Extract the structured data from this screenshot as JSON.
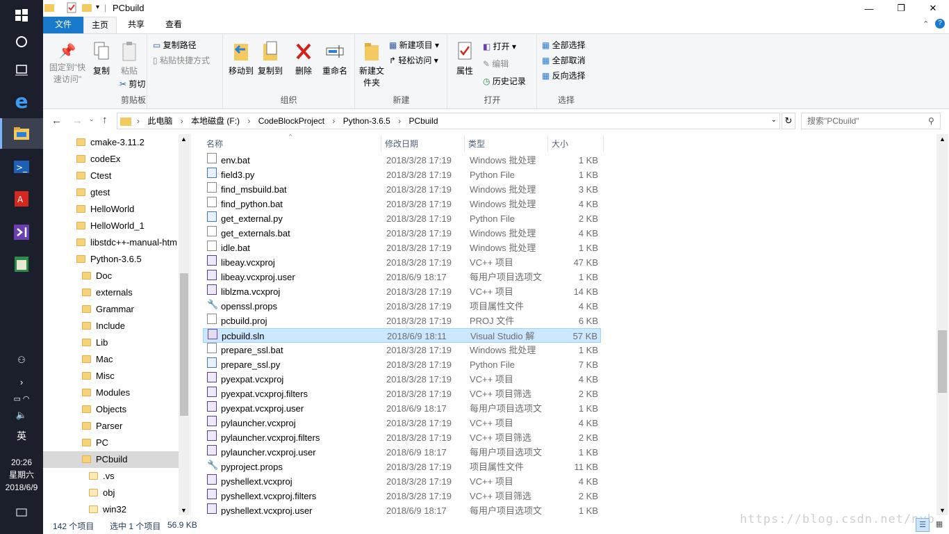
{
  "taskbar": {
    "clock_time": "20:26",
    "clock_day": "星期六",
    "clock_date": "2018/6/9",
    "ime": "英"
  },
  "window": {
    "title": "PCbuild",
    "minimize": "—",
    "maximize": "❐",
    "close": "✕"
  },
  "tabs": {
    "file": "文件",
    "home": "主页",
    "share": "共享",
    "view": "查看"
  },
  "ribbon": {
    "clipboard": {
      "pin": "固定到\"快速访问\"",
      "copy": "复制",
      "paste": "粘贴",
      "copy_path": "复制路径",
      "paste_shortcut": "粘贴快捷方式",
      "cut": "剪切",
      "label": "剪贴板"
    },
    "organize": {
      "move_to": "移动到",
      "copy_to": "复制到",
      "delete": "删除",
      "rename": "重命名",
      "label": "组织"
    },
    "new": {
      "new_folder": "新建文件夹",
      "new_item": "新建项目",
      "easy_access": "轻松访问",
      "label": "新建"
    },
    "open": {
      "properties": "属性",
      "open": "打开",
      "edit": "编辑",
      "history": "历史记录",
      "label": "打开"
    },
    "select": {
      "select_all": "全部选择",
      "select_none": "全部取消",
      "invert": "反向选择",
      "label": "选择"
    }
  },
  "address": {
    "crumbs": [
      "此电脑",
      "本地磁盘 (F:)",
      "CodeBlockProject",
      "Python-3.6.5",
      "PCbuild"
    ],
    "search_placeholder": "搜索\"PCbuild\""
  },
  "nav": {
    "items": [
      {
        "label": "cmake-3.11.2",
        "level": 0
      },
      {
        "label": "codeEx",
        "level": 0
      },
      {
        "label": "Ctest",
        "level": 0
      },
      {
        "label": "gtest",
        "level": 0
      },
      {
        "label": "HelloWorld",
        "level": 0
      },
      {
        "label": "HelloWorld_1",
        "level": 0
      },
      {
        "label": "libstdc++-manual-htm",
        "level": 0
      },
      {
        "label": "Python-3.6.5",
        "level": 0
      },
      {
        "label": "Doc",
        "level": 1
      },
      {
        "label": "externals",
        "level": 1
      },
      {
        "label": "Grammar",
        "level": 1
      },
      {
        "label": "Include",
        "level": 1
      },
      {
        "label": "Lib",
        "level": 1
      },
      {
        "label": "Mac",
        "level": 1
      },
      {
        "label": "Misc",
        "level": 1
      },
      {
        "label": "Modules",
        "level": 1
      },
      {
        "label": "Objects",
        "level": 1
      },
      {
        "label": "Parser",
        "level": 1
      },
      {
        "label": "PC",
        "level": 1
      },
      {
        "label": "PCbuild",
        "level": 1,
        "selected": true
      },
      {
        "label": ".vs",
        "level": 2
      },
      {
        "label": "obj",
        "level": 2
      },
      {
        "label": "win32",
        "level": 2
      }
    ]
  },
  "columns": {
    "name": "名称",
    "date": "修改日期",
    "type": "类型",
    "size": "大小"
  },
  "files": [
    {
      "name": "env.bat",
      "date": "2018/3/28 17:19",
      "type": "Windows 批处理",
      "size": "1 KB",
      "icon": "bat"
    },
    {
      "name": "field3.py",
      "date": "2018/3/28 17:19",
      "type": "Python File",
      "size": "1 KB",
      "icon": "py"
    },
    {
      "name": "find_msbuild.bat",
      "date": "2018/3/28 17:19",
      "type": "Windows 批处理",
      "size": "3 KB",
      "icon": "bat"
    },
    {
      "name": "find_python.bat",
      "date": "2018/3/28 17:19",
      "type": "Windows 批处理",
      "size": "4 KB",
      "icon": "bat"
    },
    {
      "name": "get_external.py",
      "date": "2018/3/28 17:19",
      "type": "Python File",
      "size": "2 KB",
      "icon": "py"
    },
    {
      "name": "get_externals.bat",
      "date": "2018/3/28 17:19",
      "type": "Windows 批处理",
      "size": "4 KB",
      "icon": "bat"
    },
    {
      "name": "idle.bat",
      "date": "2018/3/28 17:19",
      "type": "Windows 批处理",
      "size": "1 KB",
      "icon": "bat"
    },
    {
      "name": "libeay.vcxproj",
      "date": "2018/3/28 17:19",
      "type": "VC++ 项目",
      "size": "47 KB",
      "icon": "vc"
    },
    {
      "name": "libeay.vcxproj.user",
      "date": "2018/6/9 18:17",
      "type": "每用户项目选项文",
      "size": "1 KB",
      "icon": "vc"
    },
    {
      "name": "liblzma.vcxproj",
      "date": "2018/3/28 17:19",
      "type": "VC++ 项目",
      "size": "14 KB",
      "icon": "vc"
    },
    {
      "name": "openssl.props",
      "date": "2018/3/28 17:19",
      "type": "项目属性文件",
      "size": "4 KB",
      "icon": "prop"
    },
    {
      "name": "pcbuild.proj",
      "date": "2018/3/28 17:19",
      "type": "PROJ 文件",
      "size": "6 KB",
      "icon": "file"
    },
    {
      "name": "pcbuild.sln",
      "date": "2018/6/9 18:11",
      "type": "Visual Studio 解",
      "size": "57 KB",
      "icon": "sln",
      "selected": true
    },
    {
      "name": "prepare_ssl.bat",
      "date": "2018/3/28 17:19",
      "type": "Windows 批处理",
      "size": "1 KB",
      "icon": "bat"
    },
    {
      "name": "prepare_ssl.py",
      "date": "2018/3/28 17:19",
      "type": "Python File",
      "size": "7 KB",
      "icon": "py"
    },
    {
      "name": "pyexpat.vcxproj",
      "date": "2018/3/28 17:19",
      "type": "VC++ 项目",
      "size": "4 KB",
      "icon": "vc"
    },
    {
      "name": "pyexpat.vcxproj.filters",
      "date": "2018/3/28 17:19",
      "type": "VC++ 项目筛选",
      "size": "2 KB",
      "icon": "vc"
    },
    {
      "name": "pyexpat.vcxproj.user",
      "date": "2018/6/9 18:17",
      "type": "每用户项目选项文",
      "size": "1 KB",
      "icon": "vc"
    },
    {
      "name": "pylauncher.vcxproj",
      "date": "2018/3/28 17:19",
      "type": "VC++ 项目",
      "size": "4 KB",
      "icon": "vc"
    },
    {
      "name": "pylauncher.vcxproj.filters",
      "date": "2018/3/28 17:19",
      "type": "VC++ 项目筛选",
      "size": "2 KB",
      "icon": "vc"
    },
    {
      "name": "pylauncher.vcxproj.user",
      "date": "2018/6/9 18:17",
      "type": "每用户项目选项文",
      "size": "1 KB",
      "icon": "vc"
    },
    {
      "name": "pyproject.props",
      "date": "2018/3/28 17:19",
      "type": "项目属性文件",
      "size": "11 KB",
      "icon": "prop"
    },
    {
      "name": "pyshellext.vcxproj",
      "date": "2018/3/28 17:19",
      "type": "VC++ 项目",
      "size": "4 KB",
      "icon": "vc"
    },
    {
      "name": "pyshellext.vcxproj.filters",
      "date": "2018/3/28 17:19",
      "type": "VC++ 项目筛选",
      "size": "2 KB",
      "icon": "vc"
    },
    {
      "name": "pyshellext.vcxproj.user",
      "date": "2018/6/9 18:17",
      "type": "每用户项目选项文",
      "size": "1 KB",
      "icon": "vc"
    }
  ],
  "status": {
    "count": "142 个项目",
    "selected": "选中 1 个项目",
    "size": "56.9 KB"
  },
  "watermark": "https://blog.csdn.net/nyb",
  "colors": {
    "accent": "#1979ca",
    "selection": "#cce8ff",
    "taskbar": "#1a1f2b"
  }
}
